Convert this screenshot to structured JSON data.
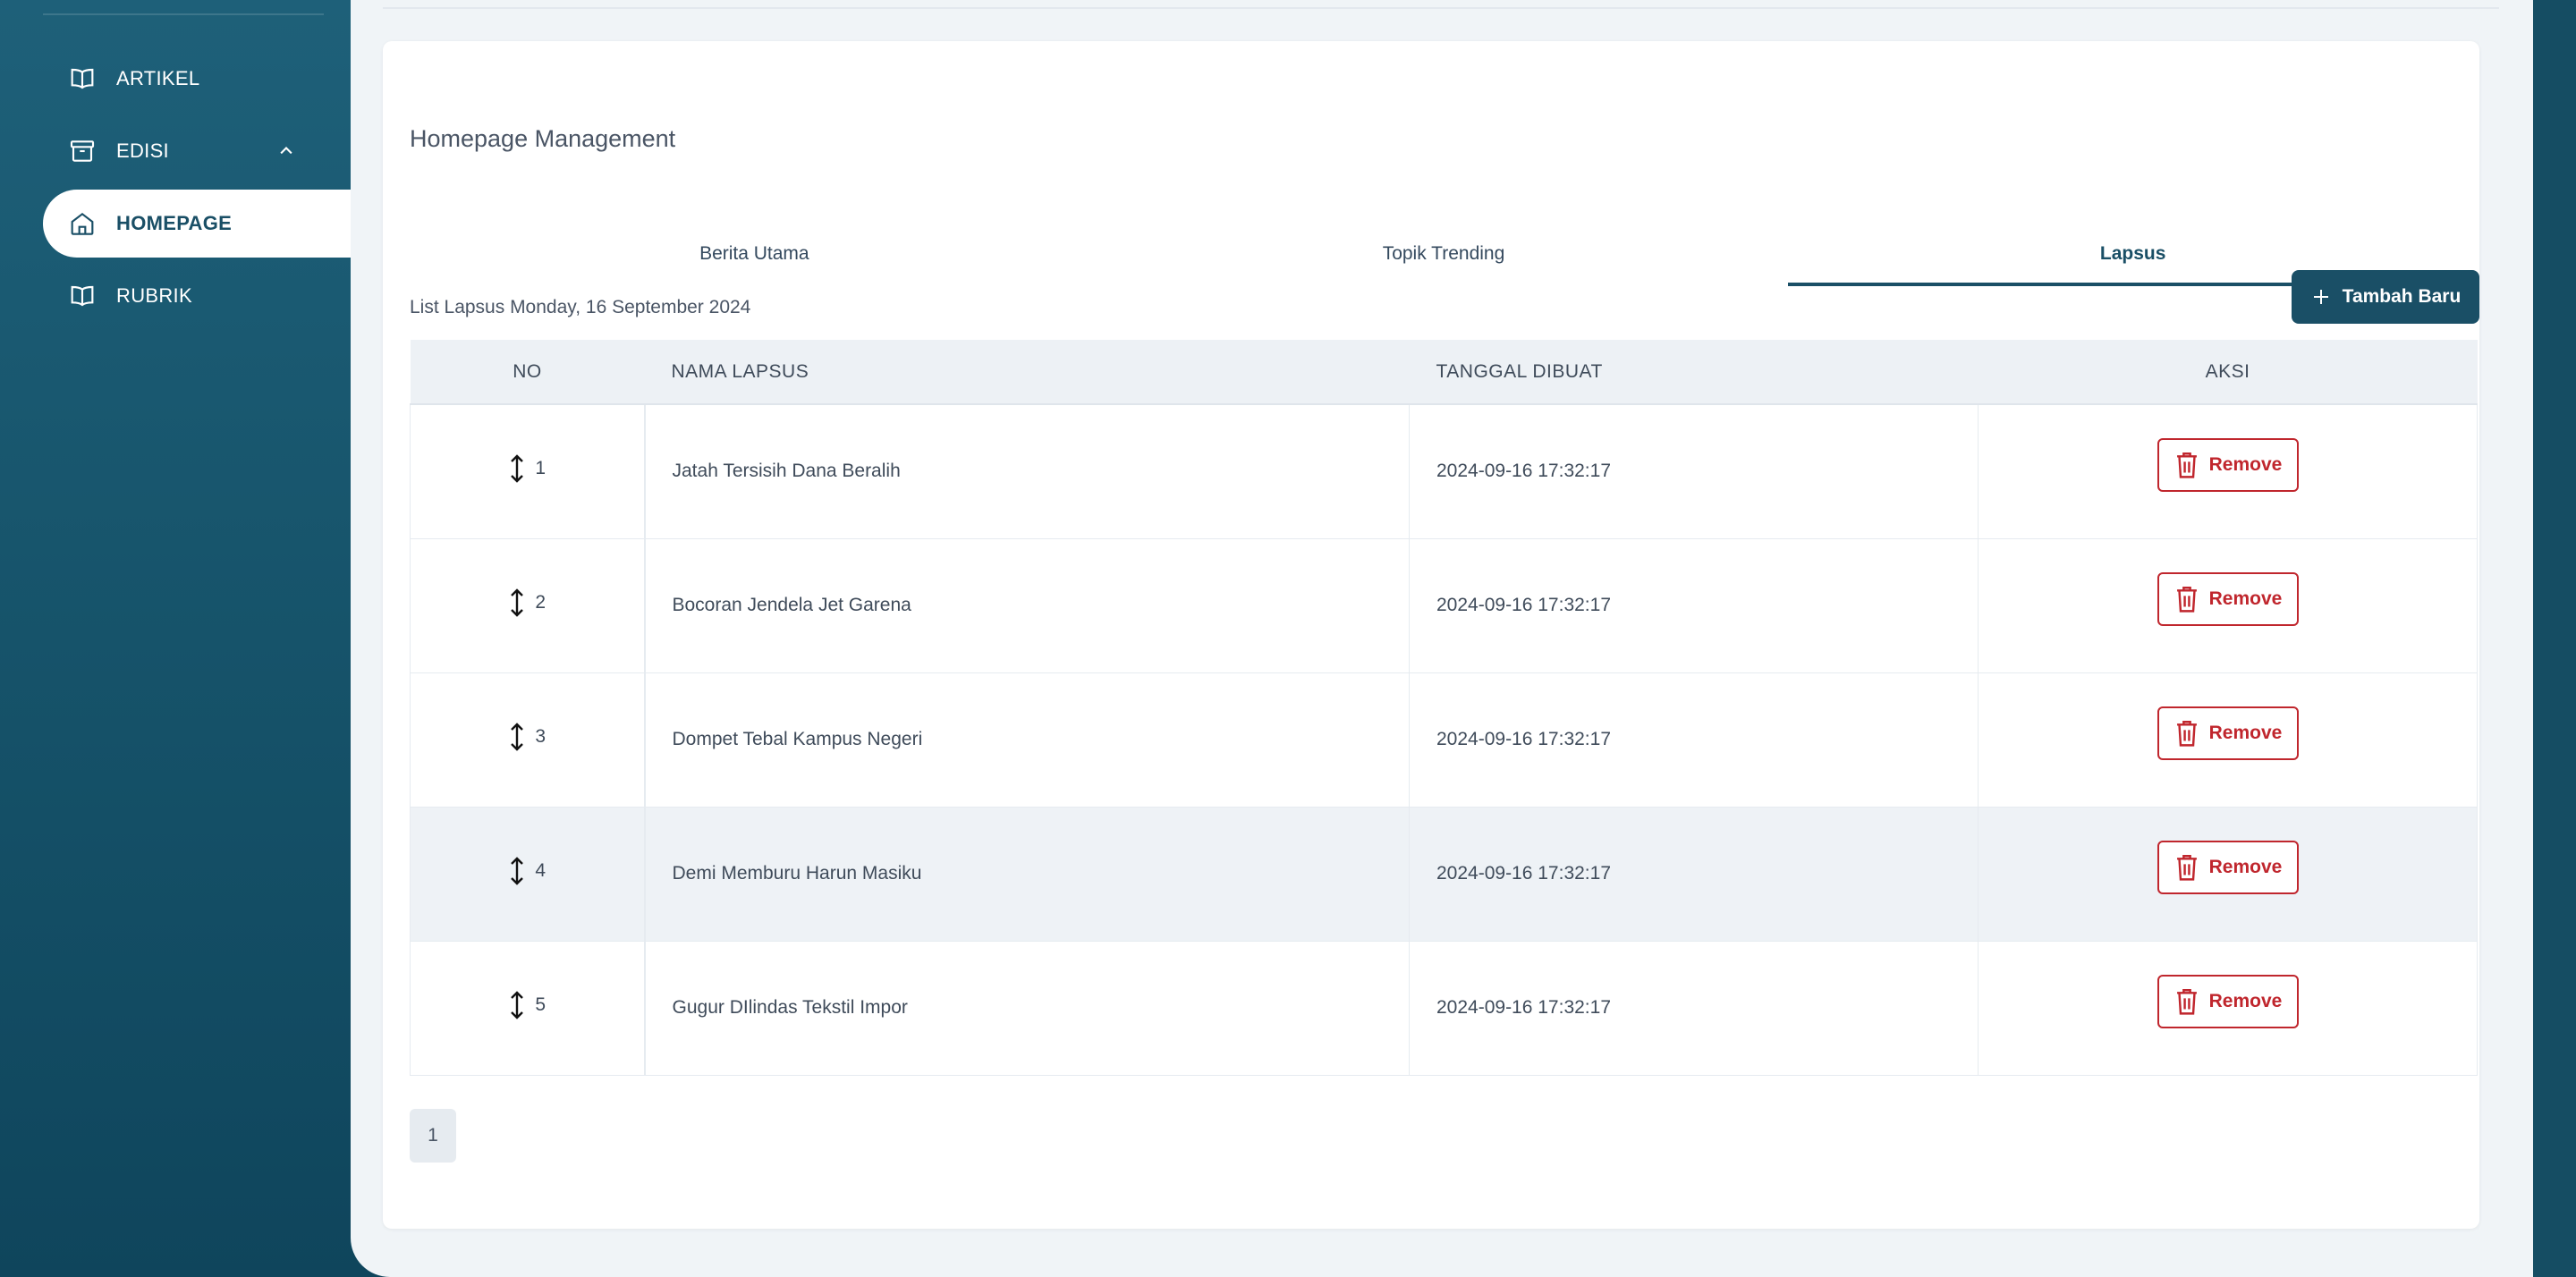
{
  "sidebar": {
    "items": [
      {
        "label": "ARTIKEL",
        "icon": "book-open-icon",
        "active": false
      },
      {
        "label": "EDISI",
        "icon": "archive-box-icon",
        "active": false,
        "expanded": true
      },
      {
        "label": "HOMEPAGE",
        "icon": "home-icon",
        "active": true
      },
      {
        "label": "RUBRIK",
        "icon": "book-open-icon",
        "active": false
      }
    ]
  },
  "main": {
    "title": "Homepage Management",
    "tabs": [
      {
        "label": "Berita Utama",
        "active": false
      },
      {
        "label": "Topik Trending",
        "active": false
      },
      {
        "label": "Lapsus",
        "active": true
      }
    ],
    "list_caption": "List Lapsus Monday, 16 September 2024",
    "add_button_label": "Tambah Baru",
    "table": {
      "headers": [
        "NO",
        "NAMA LAPSUS",
        "TANGGAL DIBUAT",
        "AKSI"
      ],
      "rows": [
        {
          "no": "1",
          "name": "Jatah Tersisih Dana Beralih",
          "date": "2024-09-16 17:32:17",
          "action": "Remove"
        },
        {
          "no": "2",
          "name": "Bocoran Jendela Jet Garena",
          "date": "2024-09-16 17:32:17",
          "action": "Remove"
        },
        {
          "no": "3",
          "name": "Dompet Tebal Kampus Negeri",
          "date": "2024-09-16 17:32:17",
          "action": "Remove"
        },
        {
          "no": "4",
          "name": "Demi Memburu Harun Masiku",
          "date": "2024-09-16 17:32:17",
          "action": "Remove"
        },
        {
          "no": "5",
          "name": "Gugur DIlindas Tekstil Impor",
          "date": "2024-09-16 17:32:17",
          "action": "Remove"
        }
      ]
    },
    "pagination": {
      "current": "1"
    }
  },
  "colors": {
    "sidebar_bg": "#1a5a72",
    "accent": "#1a4f66",
    "danger": "#c0262d",
    "panel_bg": "#f0f4f7"
  }
}
